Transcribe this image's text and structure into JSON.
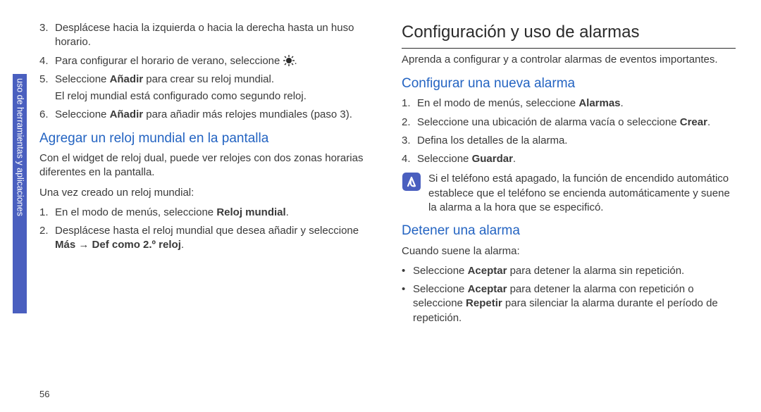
{
  "side_tab": "uso de herramientas y aplicaciones",
  "page_number": "56",
  "left": {
    "steps": [
      {
        "n": "3.",
        "text": "Desplácese hacia la izquierda o hacia la derecha hasta un huso horario."
      },
      {
        "n": "4.",
        "text_before": "Para configurar el horario de verano, seleccione ",
        "text_after": "."
      },
      {
        "n": "5.",
        "text": "Seleccione ",
        "bold": "Añadir",
        "tail": " para crear su reloj mundial."
      },
      {
        "sub": "El reloj mundial está configurado como segundo reloj."
      },
      {
        "n": "6.",
        "text": "Seleccione ",
        "bold": "Añadir",
        "tail": " para añadir más relojes mundiales (paso 3)."
      }
    ],
    "h2": "Agregar un reloj mundial en la pantalla",
    "p1": "Con el widget de reloj dual, puede ver relojes con dos zonas horarias diferentes en la pantalla.",
    "p2": "Una vez creado un reloj mundial:",
    "sub_steps": [
      {
        "n": "1.",
        "text": "En el modo de menús, seleccione ",
        "bold": "Reloj mundial",
        "tail": "."
      },
      {
        "n": "2.",
        "text": "Desplácese hasta el reloj mundial que desea añadir y seleccione ",
        "bold": "Más → Def como 2.º reloj",
        "tail": "."
      }
    ]
  },
  "right": {
    "h1": "Configuración y uso de alarmas",
    "intro": "Aprenda a configurar y a controlar alarmas de eventos importantes.",
    "h2a": "Configurar una nueva alarma",
    "steps_a": [
      {
        "n": "1.",
        "text": "En el modo de menús, seleccione ",
        "bold": "Alarmas",
        "tail": "."
      },
      {
        "n": "2.",
        "text": "Seleccione una ubicación de alarma vacía o seleccione ",
        "bold": "Crear",
        "tail": "."
      },
      {
        "n": "3.",
        "text": "Defina los detalles de la alarma."
      },
      {
        "n": "4.",
        "text": "Seleccione ",
        "bold": "Guardar",
        "tail": "."
      }
    ],
    "note": "Si el teléfono está apagado, la función de encendido automático establece que el teléfono se encienda automáticamente y suene la alarma a la hora que se especificó.",
    "h2b": "Detener una alarma",
    "p_b": "Cuando suene la alarma:",
    "bullets": [
      {
        "pre": "Seleccione ",
        "b1": "Aceptar",
        "mid": " para detener la alarma sin repetición."
      },
      {
        "pre": "Seleccione ",
        "b1": "Aceptar",
        "mid": " para detener la alarma con repetición o seleccione ",
        "b2": "Repetir",
        "tail": " para silenciar la alarma durante el período de repetición."
      }
    ]
  }
}
